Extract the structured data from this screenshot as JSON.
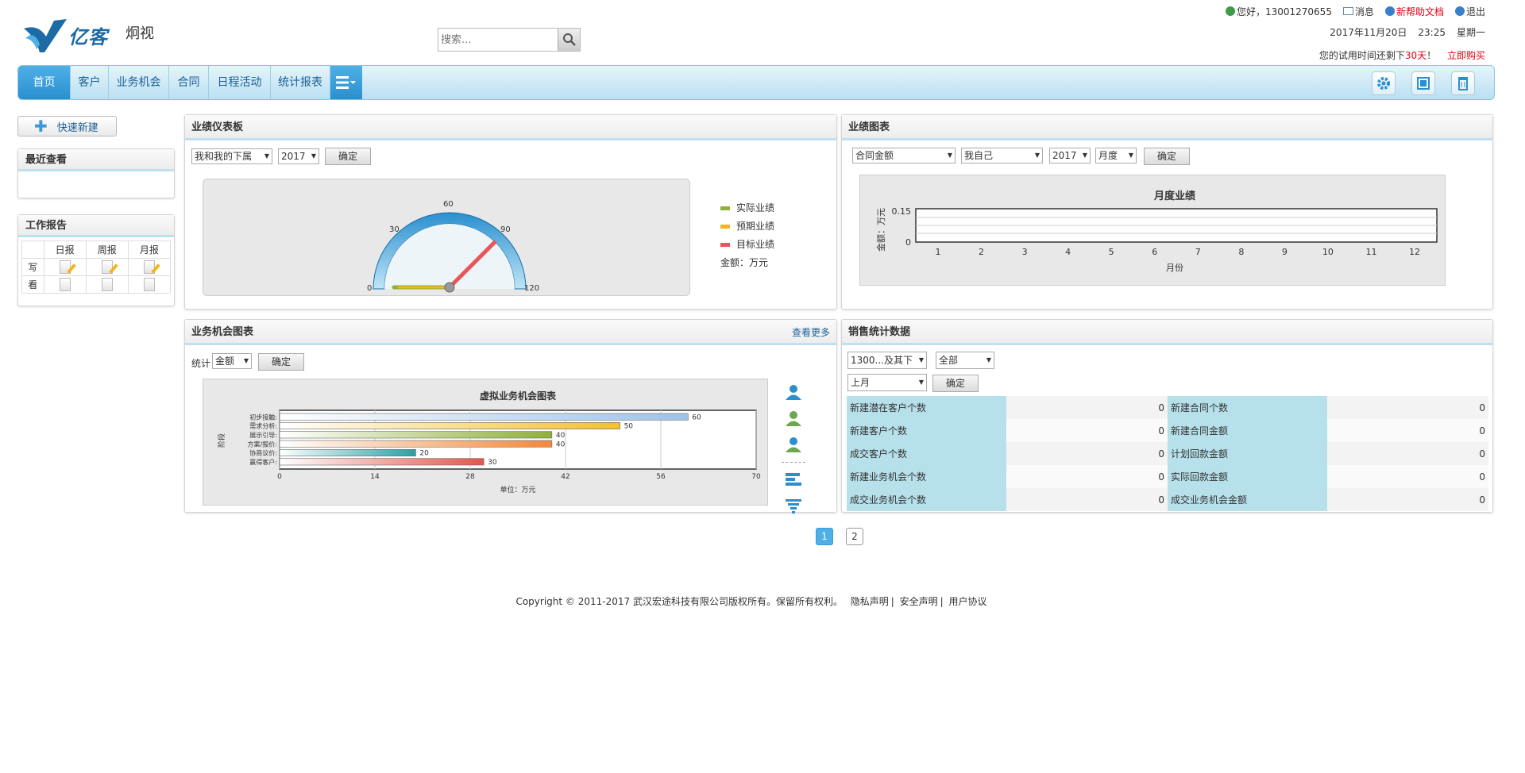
{
  "brand": {
    "logo_text": "亿客",
    "subtitle": "炯视"
  },
  "search": {
    "placeholder": "搜索..."
  },
  "topbar": {
    "greeting": "您好，13001270655",
    "message": "消息",
    "help": "新帮助文档",
    "logout": "退出",
    "date": "2017年11月20日",
    "time": "23:25",
    "weekday": "星期一",
    "trial_pre": "您的试用时间还剩下",
    "trial_days": "30天",
    "trial_post": "！",
    "buy": "立即购买"
  },
  "nav": {
    "items": [
      "首页",
      "客户",
      "业务机会",
      "合同",
      "日程活动",
      "统计报表"
    ],
    "active": "首页"
  },
  "left": {
    "quick_new": "快速新建",
    "recent_title": "最近查看",
    "report_title": "工作报告",
    "report_cols": [
      "日报",
      "周报",
      "月报"
    ],
    "report_rows": [
      "写",
      "看"
    ]
  },
  "dashboard": {
    "title": "业绩仪表板",
    "scope": "我和我的下属",
    "year": "2017",
    "confirm": "确定",
    "gauge": {
      "min": 0,
      "max": 120,
      "ticks": [
        "0",
        "30",
        "60",
        "90",
        "120"
      ],
      "actual": 0,
      "expected": 0,
      "target": 90
    },
    "legend": [
      "实际业绩",
      "预期业绩",
      "目标业绩"
    ],
    "unit": "金额：万元",
    "colors": {
      "actual": "#8fb03a",
      "expected": "#f2b51a",
      "target": "#e8565a"
    }
  },
  "perf_chart": {
    "title": "业绩图表",
    "metric": "合同金额",
    "who": "我自己",
    "year": "2017",
    "period": "月度",
    "confirm": "确定",
    "chart_title": "月度业绩",
    "ylabel": "金额：万元",
    "xlabel": "月份",
    "yticks": [
      "0.15",
      "0"
    ],
    "months": [
      "1",
      "2",
      "3",
      "4",
      "5",
      "6",
      "7",
      "8",
      "9",
      "10",
      "11",
      "12"
    ]
  },
  "opp_chart": {
    "title": "业务机会图表",
    "more": "查看更多",
    "stat_label": "统计",
    "stat_value": "金额",
    "confirm": "确定"
  },
  "chart_data": {
    "type": "bar",
    "title": "虚拟业务机会图表",
    "ylabel": "阶段",
    "xlabel": "单位：万元",
    "categories": [
      "初步接触:",
      "需求分析:",
      "展示引导:",
      "方案/报价:",
      "协商议价:",
      "赢得客户:"
    ],
    "values": [
      60,
      50,
      40,
      40,
      20,
      30
    ],
    "colors": [
      "#9cc3ea",
      "#f2c12e",
      "#8fb03a",
      "#f0893c",
      "#2aa0a6",
      "#e2574c"
    ],
    "xlim": [
      0,
      70
    ],
    "xticks": [
      0,
      14,
      28,
      42,
      56,
      70
    ],
    "grid": true
  },
  "sales": {
    "title": "销售统计数据",
    "scope": "1300...及其下",
    "filter": "全部",
    "period": "上月",
    "confirm": "确定",
    "rows": [
      {
        "l1": "新建潜在客户个数",
        "v1": "0",
        "l2": "新建合同个数",
        "v2": "0"
      },
      {
        "l1": "新建客户个数",
        "v1": "0",
        "l2": "新建合同金额",
        "v2": "0"
      },
      {
        "l1": "成交客户个数",
        "v1": "0",
        "l2": "计划回款金额",
        "v2": "0"
      },
      {
        "l1": "新建业务机会个数",
        "v1": "0",
        "l2": "实际回款金额",
        "v2": "0"
      },
      {
        "l1": "成交业务机会个数",
        "v1": "0",
        "l2": "成交业务机会金额",
        "v2": "0"
      }
    ]
  },
  "pager": {
    "pages": [
      "1",
      "2"
    ],
    "current": "1"
  },
  "footer": {
    "copyright": "Copyright © 2011-2017 武汉宏途科技有限公司版权所有。保留所有权利。",
    "links": [
      "隐私声明",
      "安全声明",
      "用户协议"
    ]
  }
}
